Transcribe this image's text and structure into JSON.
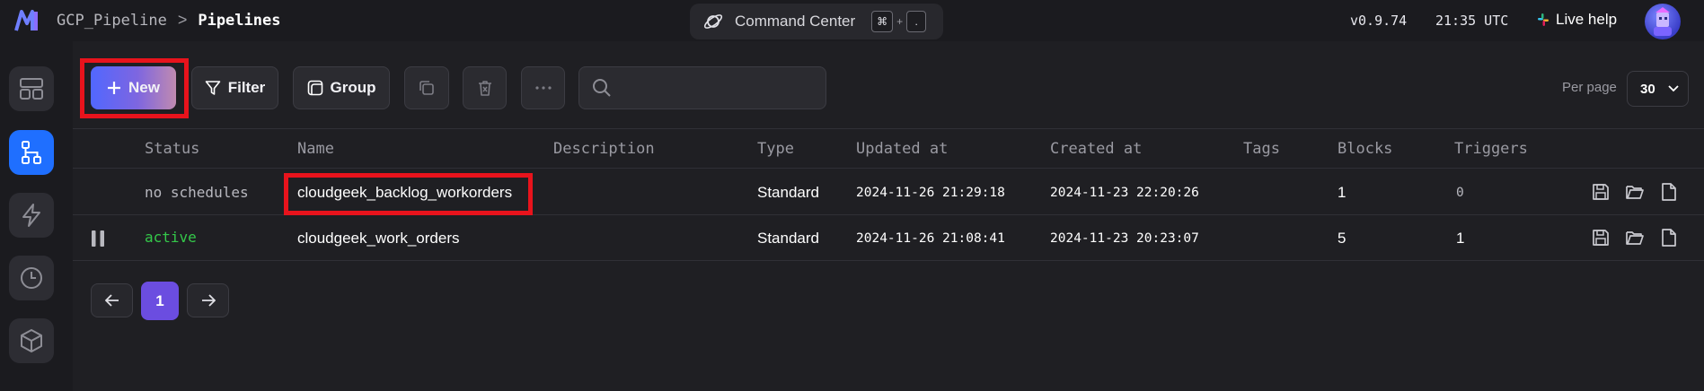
{
  "header": {
    "project": "GCP_Pipeline",
    "separator": ">",
    "current_page": "Pipelines",
    "command_center": {
      "label": "Command Center",
      "key1": "⌘",
      "plus": "+",
      "key2": "."
    },
    "version": "v0.9.74",
    "time": "21:35 UTC",
    "live_help": "Live help"
  },
  "sidebar": {
    "items": [
      {
        "name": "layout-icon",
        "active": false
      },
      {
        "name": "pipeline-tree-icon",
        "active": true
      },
      {
        "name": "lightning-icon",
        "active": false
      },
      {
        "name": "clock-icon",
        "active": false
      },
      {
        "name": "cube-icon",
        "active": false
      }
    ]
  },
  "toolbar": {
    "new_label": "New",
    "filter_label": "Filter",
    "group_label": "Group",
    "search_placeholder": "",
    "per_page_label": "Per page",
    "per_page_value": "30"
  },
  "table": {
    "columns": [
      "Status",
      "Name",
      "Description",
      "Type",
      "Updated at",
      "Created at",
      "Tags",
      "Blocks",
      "Triggers"
    ],
    "rows": [
      {
        "status": "no schedules",
        "name": "cloudgeek_backlog_workorders",
        "description": "",
        "type": "Standard",
        "updated_at": "2024-11-26 21:29:18",
        "created_at": "2024-11-23 22:20:26",
        "tags": "",
        "blocks": "1",
        "triggers": "0"
      },
      {
        "status": "active",
        "name": "cloudgeek_work_orders",
        "description": "",
        "type": "Standard",
        "updated_at": "2024-11-26 21:08:41",
        "created_at": "2024-11-23 20:23:07",
        "tags": "",
        "blocks": "5",
        "triggers": "1"
      }
    ]
  },
  "pagination": {
    "current_page": "1"
  },
  "colors": {
    "accent_blue": "#1f6fff",
    "active_green": "#34c84a",
    "page_purple": "#6b4de0",
    "highlight_red": "#e8131c"
  }
}
